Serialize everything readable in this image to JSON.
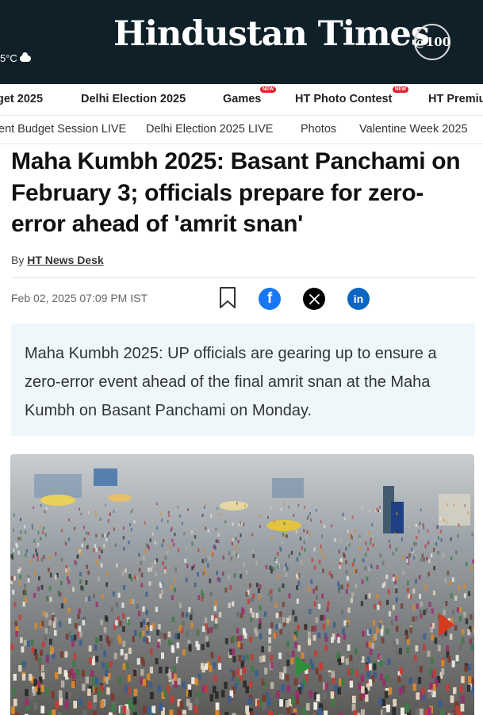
{
  "header": {
    "weather_temp": "5°C",
    "logo_text": "Hindustan Times",
    "badge_text": "@100"
  },
  "primary_nav": [
    {
      "label": "get 2025",
      "new": false
    },
    {
      "label": "Delhi Election 2025",
      "new": false
    },
    {
      "label": "Games",
      "new": true
    },
    {
      "label": "HT Photo Contest",
      "new": true
    },
    {
      "label": "HT Premiu",
      "new": false
    }
  ],
  "new_tag_label": "NEW",
  "secondary_nav": [
    "ent Budget Session LIVE",
    "Delhi Election 2025 LIVE",
    "Photos",
    "Valentine Week 2025"
  ],
  "article": {
    "headline": "Maha Kumbh 2025: Basant Panchami on February 3; officials prepare for zero-error ahead of 'amrit snan'",
    "byline_prefix": "By",
    "author": "HT News Desk",
    "date": "Feb 02, 2025 07:09 PM IST",
    "summary": "Maha Kumbh 2025: UP officials are gearing up to ensure a zero-error event ahead of the final amrit snan at the Maha Kumbh on Basant Panchami on Monday."
  },
  "share": {
    "bookmark_icon": "bookmark-icon",
    "facebook_icon": "facebook-icon",
    "x_icon": "x-icon",
    "linkedin_icon": "linkedin-icon",
    "facebook_color": "#1877f2",
    "x_color": "#000000",
    "linkedin_color": "#0a66c2"
  },
  "colors": {
    "header_bg": "#0f2028",
    "summary_bg": "#eef8fb",
    "new_tag": "#e0202a"
  }
}
